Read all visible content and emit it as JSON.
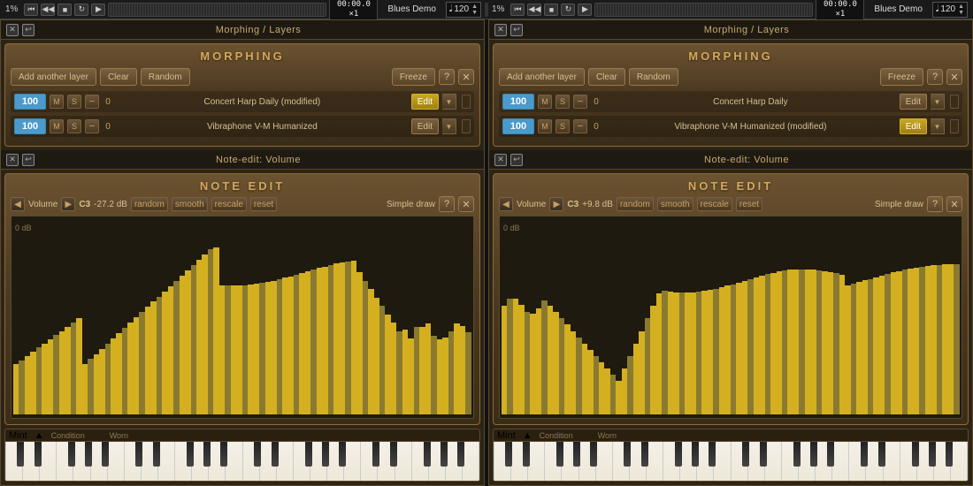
{
  "transport": {
    "percent_left": "1%",
    "percent_right": "1%",
    "time_left": "00:00.0\n×1",
    "time_right": "00:00.0\n×1",
    "song_name_left": "Blues Demo",
    "song_name_right": "Blues Demo",
    "bpm": "120"
  },
  "panel_left": {
    "topbar_title": "Morphing / Layers",
    "morphing_title": "MORPHING",
    "add_layer_label": "Add another layer",
    "clear_label": "Clear",
    "random_label": "Random",
    "freeze_label": "Freeze",
    "layers": [
      {
        "volume": "100",
        "mute": "M",
        "solo": "S",
        "minus": "−",
        "zero": "0",
        "name": "Concert Harp Daily (modified)",
        "edit_label": "Edit",
        "edit_highlighted": true
      },
      {
        "volume": "100",
        "mute": "M",
        "solo": "S",
        "minus": "−",
        "zero": "0",
        "name": "Vibraphone V-M Humanized",
        "edit_label": "Edit",
        "edit_highlighted": false
      }
    ],
    "note_edit_topbar": "Note-edit: Volume",
    "note_edit_title": "NOTE EDIT",
    "ne_vol_label": "Volume",
    "ne_note": "C3",
    "ne_db": "-27.2 dB",
    "ne_random": "random",
    "ne_smooth": "smooth",
    "ne_rescale": "rescale",
    "ne_reset": "reset",
    "ne_draw": "Simple draw",
    "ne_0db": "0 dB",
    "piano_condition": "Mint",
    "piano_worn": "Worn",
    "piano_condlabel": "Condition"
  },
  "panel_right": {
    "topbar_title": "Morphing / Layers",
    "morphing_title": "MORPHING",
    "add_layer_label": "Add another layer",
    "clear_label": "Clear",
    "random_label": "Random",
    "freeze_label": "Freeze",
    "layers": [
      {
        "volume": "100",
        "mute": "M",
        "solo": "S",
        "minus": "−",
        "zero": "0",
        "name": "Concert Harp Daily",
        "edit_label": "Edit",
        "edit_highlighted": false
      },
      {
        "volume": "100",
        "mute": "M",
        "solo": "S",
        "minus": "−",
        "zero": "0",
        "name": "Vibraphone V-M Humanized (modified)",
        "edit_label": "Edit",
        "edit_highlighted": true
      }
    ],
    "note_edit_topbar": "Note-edit: Volume",
    "note_edit_title": "NOTE EDIT",
    "ne_vol_label": "Volume",
    "ne_note": "C3",
    "ne_db": "+9.8 dB",
    "ne_random": "random",
    "ne_smooth": "smooth",
    "ne_rescale": "rescale",
    "ne_reset": "reset",
    "ne_draw": "Simple draw",
    "ne_0db": "0 dB",
    "piano_condition": "Mint",
    "piano_worn": "Worn",
    "piano_condlabel": "Condition"
  },
  "icons": {
    "close": "✕",
    "undo": "↩",
    "left_arrow": "◀",
    "right_arrow": "▶",
    "down_arrow": "▼",
    "up_arrow": "▲",
    "question": "?",
    "rewind": "⏮",
    "play": "▶",
    "stop": "■",
    "record": "●",
    "loop": "↻"
  }
}
